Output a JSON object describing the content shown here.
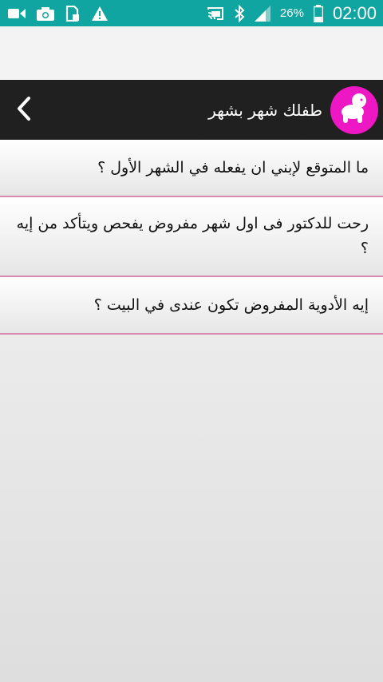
{
  "status_bar": {
    "battery_percent": "26%",
    "time": "02:00",
    "icons": [
      "video-icon",
      "camera-icon",
      "storage-icon",
      "warning-icon",
      "cast-icon",
      "bluetooth-icon",
      "signal-icon",
      "battery-icon"
    ]
  },
  "app_bar": {
    "title": "طفلك شهر بشهر",
    "logo_icon": "baby-crawling-icon",
    "back_icon": "chevron-left-icon",
    "logo_color": "#ee17c4"
  },
  "list": {
    "items": [
      {
        "text": "ما المتوقع لإبني ان يفعله في الشهر الأول ؟"
      },
      {
        "text": "رحت للدكتور فى اول شهر مفروض يفحص ويتأكد من إيه ؟"
      },
      {
        "text": "إيه الأدوية المفروض تكون عندى في البيت ؟"
      }
    ]
  },
  "colors": {
    "status_bar": "#10a5a0",
    "app_bar": "#202020",
    "divider": "#d98ab0"
  }
}
